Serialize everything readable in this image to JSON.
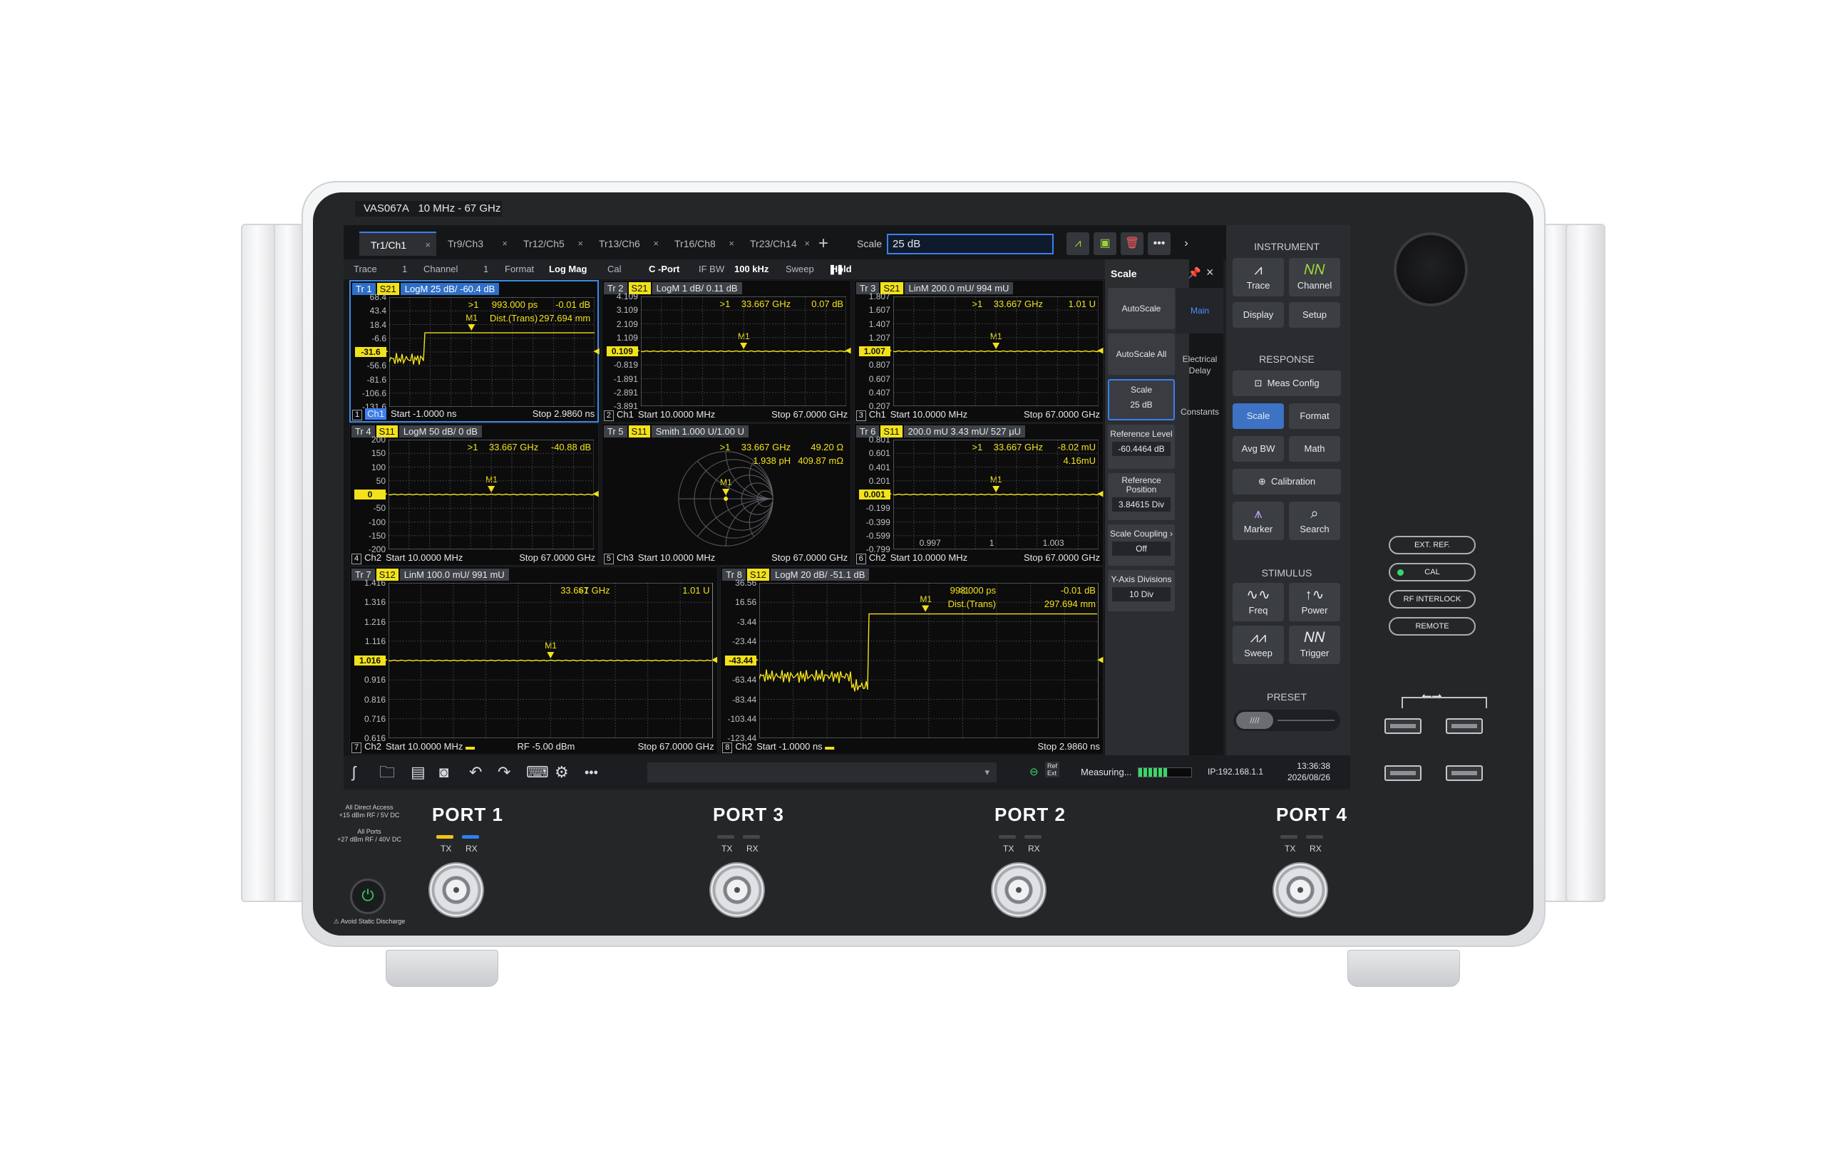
{
  "device": {
    "model": "VAS067A",
    "range": "10 MHz - 67 GHz",
    "panel_buttons": [
      "EXT. REF.",
      "CAL",
      "RF INTERLOCK",
      "REMOTE"
    ],
    "ports": [
      "PORT 1",
      "PORT 3",
      "PORT 2",
      "PORT 4"
    ],
    "tx": "TX",
    "rx": "RX",
    "note_direct_1": "All Direct Access",
    "note_direct_2": "+15 dBm RF / 5V DC",
    "note_ports_1": "All Ports",
    "note_ports_2": "+27 dBm RF / 40V DC",
    "static_note": "Avoid Static Discharge",
    "colors": {
      "accent": "#3c7ff0",
      "trace": "#f2e219",
      "tx_led": "#f2c316",
      "rx_led": "#2e7ff2",
      "cal_led": "#3ad66a"
    }
  },
  "tabs": [
    {
      "label": "Tr1/Ch1"
    },
    {
      "label": "Tr9/Ch3"
    },
    {
      "label": "Tr12/Ch5"
    },
    {
      "label": "Tr13/Ch6"
    },
    {
      "label": "Tr16/Ch8"
    },
    {
      "label": "Tr23/Ch14"
    }
  ],
  "tab_add": "+",
  "tab_close": "×",
  "scale_entry": {
    "label": "Scale",
    "value": "25 dB"
  },
  "status": {
    "trace_label": "Trace",
    "trace_value": "1",
    "channel_label": "Channel",
    "channel_value": "1",
    "format_label": "Format",
    "format_value": "Log Mag",
    "cal_label": "Cal",
    "cal_value": "C -Port",
    "ifbw_label": "IF BW",
    "ifbw_value": "100 kHz",
    "sweep_label": "Sweep",
    "sweep_value": "Hold"
  },
  "traces": [
    {
      "num": "Tr 1",
      "sparam": "S21",
      "fmt": "LogM 25 dB/ -60.4 dB",
      "ticks": [
        "68.4",
        "43.4",
        "18.4",
        "-6.6",
        "-31.6",
        "-56.6",
        "-81.6",
        "-106.6",
        "-131.6"
      ],
      "ref": "-31.6",
      "m1": ">1",
      "m1a": "993.000 ps",
      "m1b": "-0.01 dB",
      "m2a": "Dist.(Trans)",
      "m2b": "297.694 mm",
      "idx": "1",
      "ch": "Ch1",
      "start": "Start  -1.0000 ns",
      "stop": "Stop  2.9860 ns"
    },
    {
      "num": "Tr 2",
      "sparam": "S21",
      "fmt": "LogM 1 dB/ 0.11 dB",
      "ticks": [
        "4.109",
        "3.109",
        "2.109",
        "1.109",
        "0.109",
        "-0.819",
        "-1.891",
        "-2.891",
        "-3.891"
      ],
      "ref": "0.109",
      "m1": ">1",
      "m1a": "33.667 GHz",
      "m1b": "0.07 dB",
      "idx": "2",
      "ch": "Ch1",
      "start": "Start  10.0000 MHz",
      "stop": "Stop  67.0000 GHz"
    },
    {
      "num": "Tr 3",
      "sparam": "S21",
      "fmt": "LinM 200.0 mU/ 994 mU",
      "ticks": [
        "1.807",
        "1.607",
        "1.407",
        "1.207",
        "1.007",
        "0.807",
        "0.607",
        "0.407",
        "0.207"
      ],
      "ref": "1.007",
      "m1": ">1",
      "m1a": "33.667 GHz",
      "m1b": "1.01 U",
      "idx": "3",
      "ch": "Ch1",
      "start": "Start  10.0000 MHz",
      "stop": "Stop  67.0000 GHz"
    },
    {
      "num": "Tr 4",
      "sparam": "S11",
      "fmt": "LogM 50 dB/ 0 dB",
      "ticks": [
        "200",
        "150",
        "100",
        "50",
        "0",
        "-50",
        "-100",
        "-150",
        "-200"
      ],
      "ref": "0",
      "m1": ">1",
      "m1a": "33.667 GHz",
      "m1b": "-40.88 dB",
      "idx": "4",
      "ch": "Ch2",
      "start": "Start  10.0000 MHz",
      "stop": "Stop  67.0000 GHz"
    },
    {
      "num": "Tr 5",
      "sparam": "S11",
      "fmt": "Smith 1.000 U/1.00 U",
      "m1": ">1",
      "m1a": "33.667 GHz",
      "m1b": "49.20 Ω",
      "m2a": "1.938 pH",
      "m2b": "409.87 mΩ",
      "idx": "5",
      "ch": "Ch3",
      "start": "Start  10.0000 MHz",
      "stop": "Stop  67.0000 GHz"
    },
    {
      "num": "Tr 6",
      "sparam": "S11",
      "fmt": "200.0 mU 3.43 mU/ 527 µU",
      "ticks": [
        "0.801",
        "0.601",
        "0.401",
        "0.201",
        "0.001",
        "-0.199",
        "-0.399",
        "-0.599",
        "-0.799"
      ],
      "ref": "0.001",
      "m1": ">1",
      "m1a": "33.667 GHz",
      "m1b": "-8.02 mU",
      "m2b": "4.16mU",
      "xticks": [
        "0.997",
        "1",
        "1.003"
      ],
      "idx": "6",
      "ch": "Ch2",
      "start": "Start  10.0000 MHz",
      "stop": "Stop  67.0000 GHz"
    },
    {
      "num": "Tr 7",
      "sparam": "S12",
      "fmt": "LinM 100.0 mU/ 991 mU",
      "ticks": [
        "1.416",
        "1.316",
        "1.216",
        "1.116",
        "1.016",
        "0.916",
        "0.816",
        "0.716",
        "0.616"
      ],
      "ref": "1.016",
      "m1": ">1",
      "m1a": "33.667 GHz",
      "m1b": "1.01 U",
      "idx": "7",
      "ch": "Ch2",
      "start": "Start  10.0000 MHz",
      "rf": "RF    -5.00 dBm",
      "stop": "Stop  67.0000 GHz"
    },
    {
      "num": "Tr 8",
      "sparam": "S12",
      "fmt": "LogM 20 dB/ -51.1 dB",
      "ticks": [
        "36.56",
        "16.56",
        "-3.44",
        "-23.44",
        "-43.44",
        "-63.44",
        "-83.44",
        "-103.44",
        "-123.44"
      ],
      "ref": "-43.44",
      "m1": ">1",
      "m1a": "993.000 ps",
      "m1b": "-0.01 dB",
      "m2a": "Dist.(Trans)",
      "m2b": "297.694 mm",
      "idx": "8",
      "ch": "Ch2",
      "start": "Start  -1.0000 ns",
      "stop": "Stop  2.9860 ns"
    }
  ],
  "marker_label": "M1",
  "scale_panel": {
    "title": "Scale",
    "autoscale": "AutoScale",
    "autoscale_all": "AutoScale All",
    "scale_label": "Scale",
    "scale_value": "25 dB",
    "ref_level_label": "Reference Level",
    "ref_level_value": "-60.4464 dB",
    "ref_pos_label": "Reference Position",
    "ref_pos_value": "3.84615 Div",
    "coupling_label": "Scale Coupling",
    "coupling_value": "Off",
    "ydiv_label": "Y-Axis Divisions",
    "ydiv_value": "10 Div",
    "tab_main": "Main",
    "tab_delay": "Electrical Delay",
    "tab_constants": "Constants"
  },
  "hard_keys": {
    "instrument": "INSTRUMENT",
    "trace": "Trace",
    "channel": "Channel",
    "display": "Display",
    "setup": "Setup",
    "response": "RESPONSE",
    "meas_config": "Meas Config",
    "scale": "Scale",
    "format": "Format",
    "avg_bw": "Avg BW",
    "math": "Math",
    "calibration": "Calibration",
    "marker": "Marker",
    "search": "Search",
    "stimulus": "STIMULUS",
    "freq": "Freq",
    "power": "Power",
    "sweep": "Sweep",
    "trigger": "Trigger",
    "preset": "PRESET"
  },
  "taskbar": {
    "measuring": "Measuring...",
    "ip": "IP:192.168.1.1",
    "time": "13:36:38",
    "date": "2026/08/26",
    "ref_ext_1": "Ref",
    "ref_ext_2": "Ext"
  }
}
